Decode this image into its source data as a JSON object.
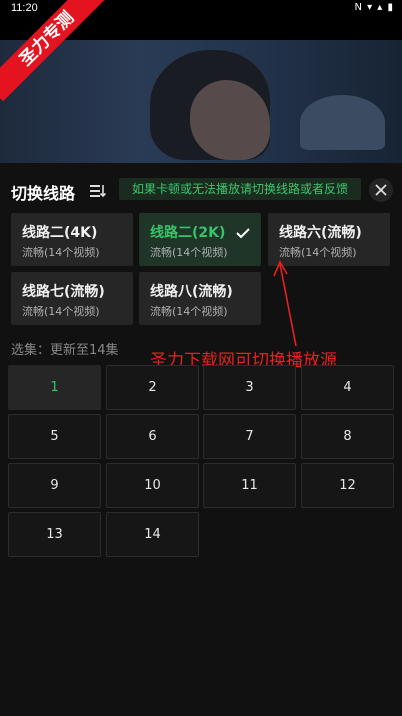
{
  "status_bar": {
    "time": "11:20",
    "icons": "N ▾ ▴ ▮"
  },
  "banner": {
    "text": "圣力专测"
  },
  "header": {
    "title": "切换线路",
    "notice": "如果卡顿或无法播放请切换线路或者反馈"
  },
  "lines": [
    {
      "name": "线路二(4K)",
      "sub": "流畅(14个视频)",
      "active": false
    },
    {
      "name": "线路二(2K)",
      "sub": "流畅(14个视频)",
      "active": true
    },
    {
      "name": "线路六(流畅)",
      "sub": "流畅(14个视频)",
      "active": false
    },
    {
      "name": "线路七(流畅)",
      "sub": "流畅(14个视频)",
      "active": false
    },
    {
      "name": "线路八(流畅)",
      "sub": "流畅(14个视频)",
      "active": false
    }
  ],
  "episodes_label": "选集：更新至14集",
  "episodes": [
    "1",
    "2",
    "3",
    "4",
    "5",
    "6",
    "7",
    "8",
    "9",
    "10",
    "11",
    "12",
    "13",
    "14"
  ],
  "selected_episode": "1",
  "annotation": "圣力下载网可切换播放源",
  "colors": {
    "accent": "#37c36a",
    "annotation": "#e82020",
    "banner": "#e3141f"
  }
}
